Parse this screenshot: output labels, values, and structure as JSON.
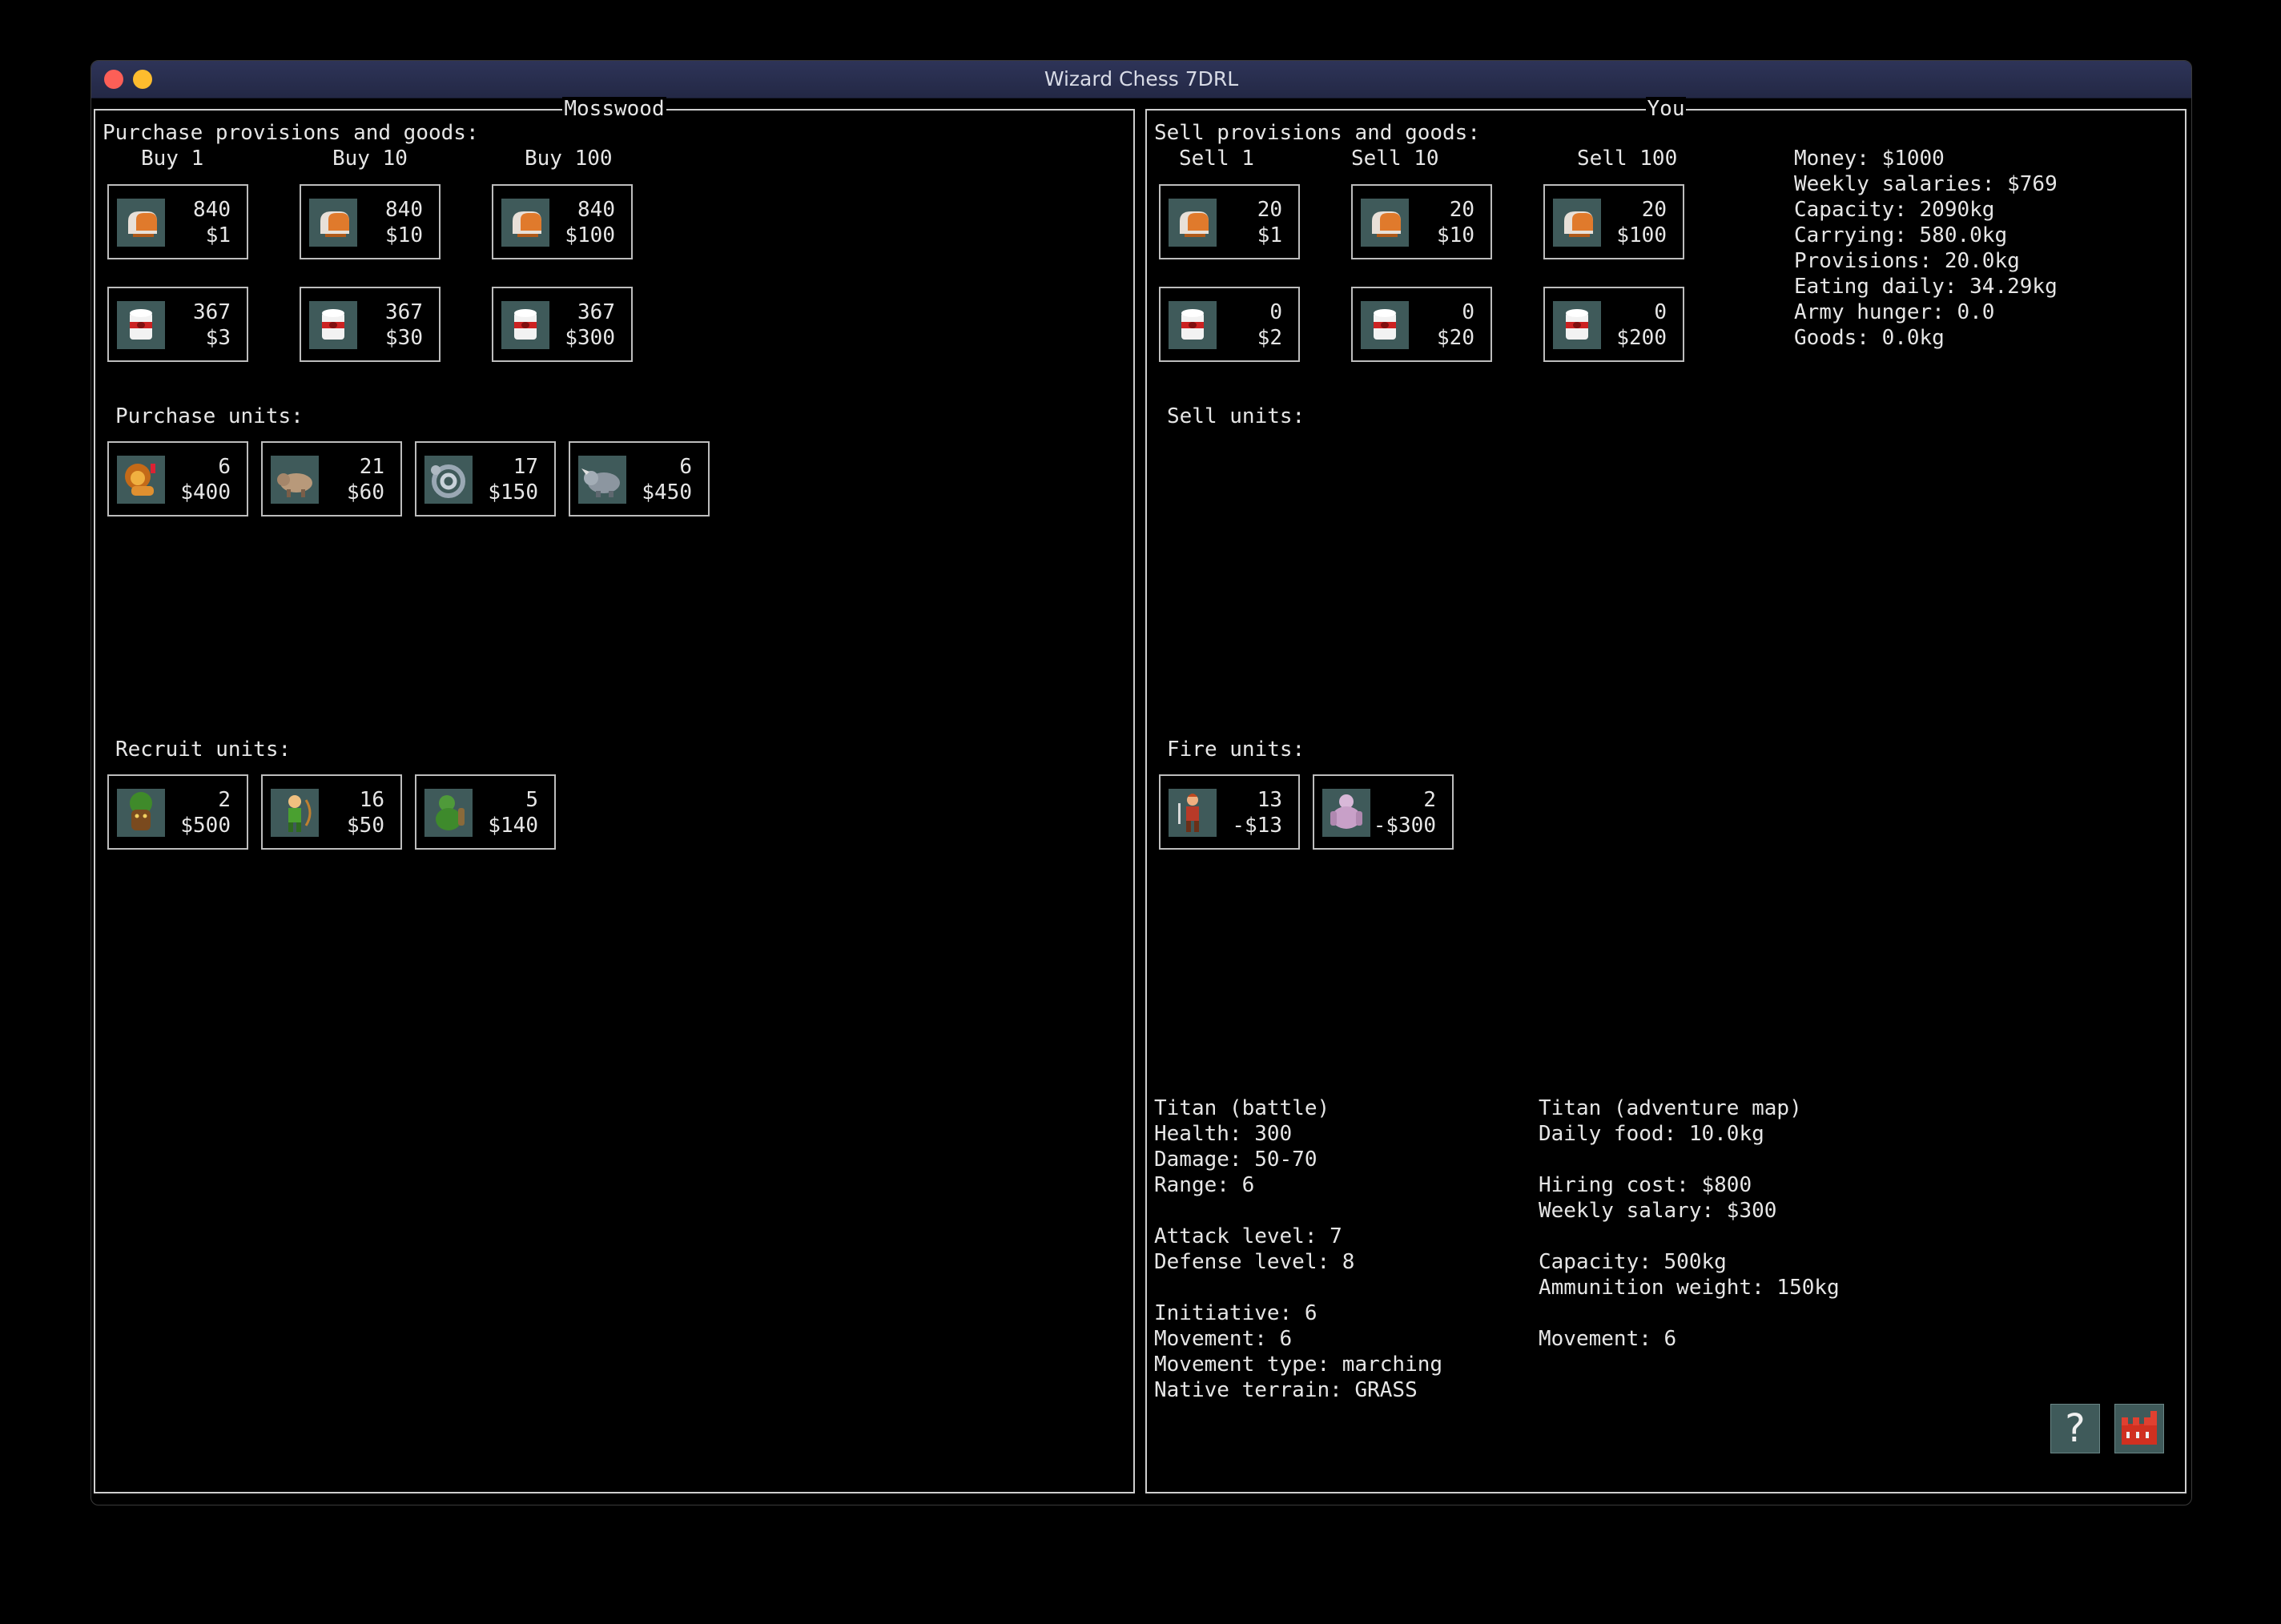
{
  "window": {
    "title": "Wizard Chess 7DRL"
  },
  "left_panel": {
    "title": "Mosswood",
    "provisions_header": "Purchase provisions and goods:",
    "col_labels": [
      "Buy 1",
      "Buy 10",
      "Buy 100"
    ],
    "food_tiles": [
      {
        "qty": "840",
        "price": "$1"
      },
      {
        "qty": "840",
        "price": "$10"
      },
      {
        "qty": "840",
        "price": "$100"
      }
    ],
    "goods_tiles": [
      {
        "qty": "367",
        "price": "$3"
      },
      {
        "qty": "367",
        "price": "$30"
      },
      {
        "qty": "367",
        "price": "$300"
      }
    ],
    "purchase_units_header": "Purchase units:",
    "purchase_units": [
      {
        "icon": "lion-unit-icon",
        "qty": "6",
        "price": "$400"
      },
      {
        "icon": "boar-unit-icon",
        "qty": "21",
        "price": "$60"
      },
      {
        "icon": "serpent-unit-icon",
        "qty": "17",
        "price": "$150"
      },
      {
        "icon": "rhino-unit-icon",
        "qty": "6",
        "price": "$450"
      }
    ],
    "recruit_units_header": "Recruit units:",
    "recruit_units": [
      {
        "icon": "treant-unit-icon",
        "qty": "2",
        "price": "$500"
      },
      {
        "icon": "elf-archer-unit-icon",
        "qty": "16",
        "price": "$50"
      },
      {
        "icon": "green-ogre-unit-icon",
        "qty": "5",
        "price": "$140"
      }
    ]
  },
  "right_panel": {
    "title": "You",
    "provisions_header": "Sell provisions and goods:",
    "col_labels": [
      "Sell 1",
      "Sell 10",
      "Sell 100"
    ],
    "food_tiles": [
      {
        "qty": "20",
        "price": "$1"
      },
      {
        "qty": "20",
        "price": "$10"
      },
      {
        "qty": "20",
        "price": "$100"
      }
    ],
    "goods_tiles": [
      {
        "qty": "0",
        "price": "$2"
      },
      {
        "qty": "0",
        "price": "$20"
      },
      {
        "qty": "0",
        "price": "$200"
      }
    ],
    "stats": [
      "Money: $1000",
      "Weekly salaries: $769",
      "Capacity: 2090kg",
      "Carrying: 580.0kg",
      "Provisions: 20.0kg",
      "Eating daily: 34.29kg",
      "Army hunger: 0.0",
      "Goods: 0.0kg"
    ],
    "sell_units_header": "Sell units:",
    "fire_units_header": "Fire units:",
    "fire_units": [
      {
        "icon": "warrior-unit-icon",
        "qty": "13",
        "price": "-$13"
      },
      {
        "icon": "titan-unit-icon",
        "qty": "2",
        "price": "-$300"
      }
    ],
    "info_battle": [
      "Titan (battle)",
      "Health: 300",
      "Damage: 50-70",
      "Range: 6",
      "",
      "Attack level: 7",
      "Defense level: 8",
      "",
      "Initiative: 6",
      "Movement: 6",
      "Movement type: marching",
      "Native terrain: GRASS"
    ],
    "info_map": [
      "Titan (adventure map)",
      "Daily food: 10.0kg",
      "",
      "Hiring cost: $800",
      "Weekly salary: $300",
      "",
      "Capacity: 500kg",
      "Ammunition weight: 150kg",
      "",
      "Movement: 6"
    ],
    "help_button": "?"
  },
  "colors": {
    "tile_bg": "#3f5a5a",
    "border": "#cfcfcf",
    "titlebar": "#2e3458"
  }
}
